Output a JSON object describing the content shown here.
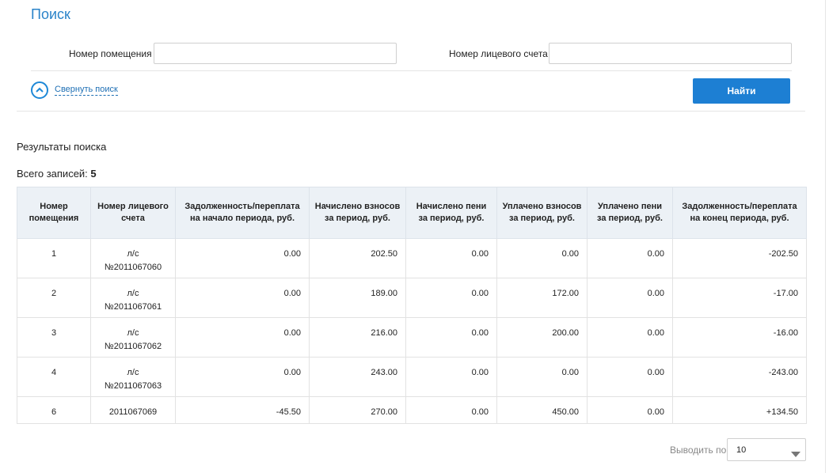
{
  "search": {
    "title": "Поиск",
    "premises_label": "Номер помещения",
    "premises_value": "",
    "account_label": "Номер лицевого счета",
    "account_value": "",
    "collapse_label": "Свернуть поиск",
    "find_label": "Найти"
  },
  "results": {
    "title": "Результаты поиска",
    "total_label": "Всего записей:",
    "total_value": "5",
    "columns": [
      "Номер помещения",
      "Номер лицевого счета",
      "Задолженность/переплата на начало периода, руб.",
      "Начислено взносов за период, руб.",
      "Начислено пени за период, руб.",
      "Уплачено взносов за период, руб.",
      "Уплачено пени за период, руб.",
      "Задолженность/переплата на конец периода, руб."
    ],
    "rows": [
      [
        "1",
        "л/с №2011067060",
        "0.00",
        "202.50",
        "0.00",
        "0.00",
        "0.00",
        "-202.50"
      ],
      [
        "2",
        "л/с №2011067061",
        "0.00",
        "189.00",
        "0.00",
        "172.00",
        "0.00",
        "-17.00"
      ],
      [
        "3",
        "л/с №2011067062",
        "0.00",
        "216.00",
        "0.00",
        "200.00",
        "0.00",
        "-16.00"
      ],
      [
        "4",
        "л/с №2011067063",
        "0.00",
        "243.00",
        "0.00",
        "0.00",
        "0.00",
        "-243.00"
      ],
      [
        "6",
        "2011067069",
        "-45.50",
        "270.00",
        "0.00",
        "450.00",
        "0.00",
        "+134.50"
      ]
    ]
  },
  "pagination": {
    "per_page_label": "Выводить по",
    "per_page_value": "10"
  },
  "colors": {
    "accent": "#1d7fd3",
    "negative": "#c0161c",
    "positive": "#2e8b1e",
    "header_bg": "#ecf1f6"
  }
}
